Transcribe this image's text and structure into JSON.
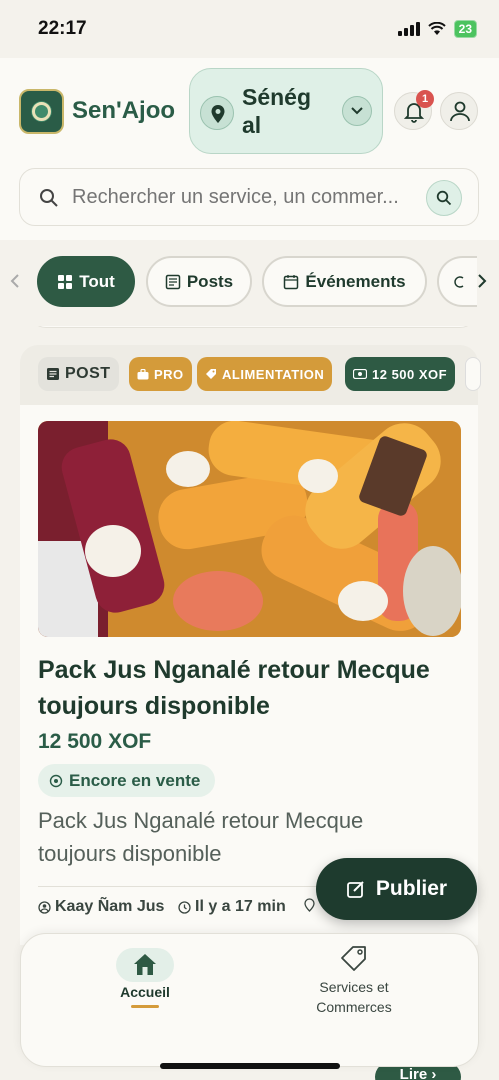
{
  "status_bar": {
    "time": "22:17",
    "battery": "23"
  },
  "header": {
    "brand": "Sen'Ajoo",
    "country": "Sénég al",
    "notifications_count": "1"
  },
  "search": {
    "placeholder": "Rechercher un service, un commer..."
  },
  "filters": [
    {
      "label": "Tout",
      "icon": "grid-icon",
      "active": true
    },
    {
      "label": "Posts",
      "icon": "newspaper-icon",
      "active": false
    },
    {
      "label": "Événements",
      "icon": "calendar-icon",
      "active": false
    }
  ],
  "post": {
    "tags": {
      "type": "POST",
      "pro": "PRO",
      "category": "ALIMENTATION",
      "price": "12 500 XOF"
    },
    "title": "Pack Jus Nganalé  retour Mecque toujours disponible",
    "price": "12 500 XOF",
    "status": "Encore en vente",
    "description": "Pack Jus Nganalé  retour Mecque toujours disponible",
    "author": "Kaay Ñam Jus",
    "time_ago": "Il y a 17 min"
  },
  "publish_button": "Publier",
  "read_button": "Lire",
  "bottom_nav": {
    "home": "Accueil",
    "services": "Services et Commerces"
  },
  "colors": {
    "primary": "#2e5a44",
    "accent": "#d49b3a",
    "background": "#f4f2ec",
    "badge": "#d9534f"
  }
}
